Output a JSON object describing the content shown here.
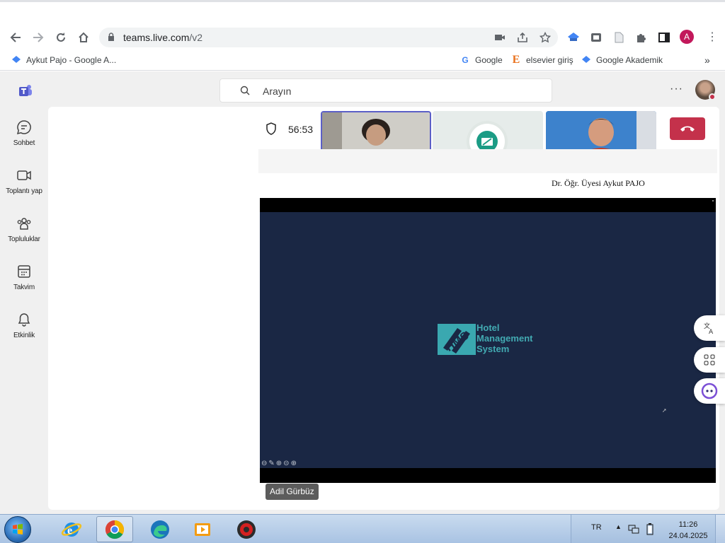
{
  "browser": {
    "url_host": "teams.live.com",
    "url_path": "/v2",
    "profile_initial": "A",
    "bookmarks": [
      {
        "label": "Aykut Pajo - Google A..."
      },
      {
        "label": "Google"
      },
      {
        "label": "elsevier giriş"
      },
      {
        "label": "Google Akademik"
      }
    ],
    "more_bookmarks": "»"
  },
  "teams": {
    "search_placeholder": "Arayın",
    "more": "···",
    "rail": [
      {
        "label": "Sohbet",
        "icon": "chat-icon"
      },
      {
        "label": "Toplantı yap",
        "icon": "video-icon"
      },
      {
        "label": "Topluluklar",
        "icon": "communities-icon"
      },
      {
        "label": "Takvim",
        "icon": "calendar-icon"
      },
      {
        "label": "Etkinlik",
        "icon": "bell-icon"
      }
    ],
    "call": {
      "timer": "56:53",
      "speaker_name": "Dr. Öğr. Üyesi Aykut PAJO",
      "presenter_name": "Adil Gürbüz",
      "hangup_color": "#c4314b",
      "active_tile_border": "#5b5fc7"
    },
    "slide": {
      "logo_text_1": "Hotel",
      "logo_text_2": "Management",
      "logo_text_3": "System",
      "background": "#1a2744",
      "accent": "#42aab2"
    }
  },
  "taskbar": {
    "language": "TR",
    "time": "11:26",
    "date": "24.04.2025",
    "apps": [
      "internet-explorer",
      "chrome",
      "edge",
      "media-player",
      "app-red"
    ]
  }
}
